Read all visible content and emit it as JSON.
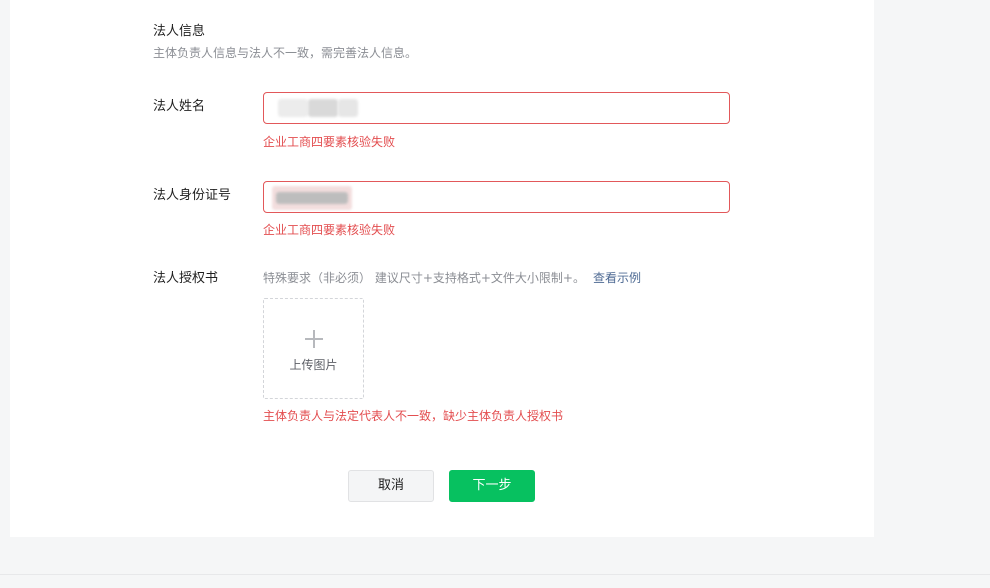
{
  "section": {
    "title": "法人信息",
    "description": "主体负责人信息与法人不一致，需完善法人信息。"
  },
  "fields": {
    "legal_name": {
      "label": "法人姓名",
      "value": "",
      "error": "企业工商四要素核验失败"
    },
    "legal_id": {
      "label": "法人身份证号",
      "value": "",
      "error": "企业工商四要素核验失败"
    },
    "authorization": {
      "label": "法人授权书",
      "hint": "特殊要求（非必须） 建议尺寸+支持格式+文件大小限制+。",
      "example_link": "查看示例",
      "upload_label": "上传图片",
      "error": "主体负责人与法定代表人不一致，缺少主体负责人授权书"
    }
  },
  "actions": {
    "cancel_label": "取消",
    "next_label": "下一步"
  },
  "colors": {
    "error": "#e34d4f",
    "input_error_border": "#e2585a",
    "primary": "#07c160",
    "link": "#4f6b94"
  },
  "icons": {
    "upload": "plus-icon"
  }
}
